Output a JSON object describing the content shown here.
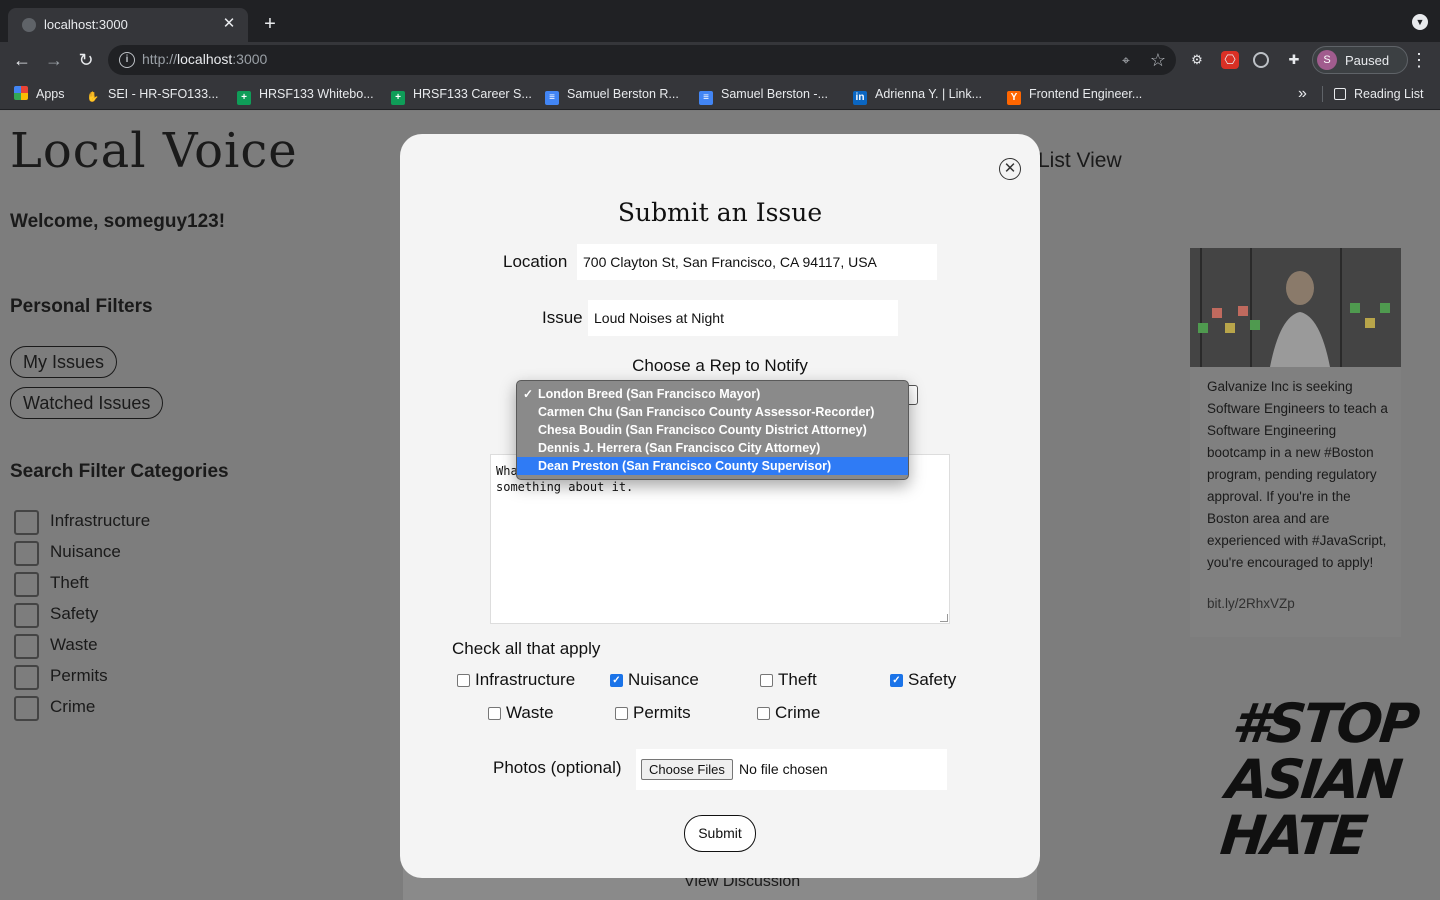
{
  "browser": {
    "tab_title": "localhost:3000",
    "url_scheme": "http://",
    "url_host": "localhost",
    "url_port": ":3000",
    "profile_initial": "S",
    "profile_label": "Paused",
    "bookmarks": [
      {
        "label": "Apps",
        "icon": "apps-grid-icon"
      },
      {
        "label": "SEI - HR-SFO133...",
        "icon": "hand-icon"
      },
      {
        "label": "HRSF133 Whitebo...",
        "icon": "sheets-icon"
      },
      {
        "label": "HRSF133 Career S...",
        "icon": "sheets-icon"
      },
      {
        "label": "Samuel Berston R...",
        "icon": "docs-icon"
      },
      {
        "label": "Samuel Berston -...",
        "icon": "docs-icon"
      },
      {
        "label": "Adrienna Y. | Link...",
        "icon": "linkedin-icon"
      },
      {
        "label": "Frontend Engineer...",
        "icon": "ycombinator-icon"
      }
    ],
    "reading_list": "Reading List"
  },
  "page": {
    "logo": "Local Voice",
    "welcome": "Welcome, someguy123!",
    "personal_filters_heading": "Personal Filters",
    "my_issues": "My Issues",
    "watched_issues": "Watched Issues",
    "search_filter_heading": "Search Filter Categories",
    "categories": [
      "Infrastructure",
      "Nuisance",
      "Theft",
      "Safety",
      "Waste",
      "Permits",
      "Crime"
    ],
    "list_view_partial": "List View",
    "ad_text": "Galvanize Inc is seeking Software Engineers to teach a Software Engineering bootcamp in a new #Boston program, pending regulatory approval. If you're in the Boston area and are experienced with #JavaScript, you're encouraged to apply!",
    "ad_link": "bit.ly/2RhxVZp",
    "stop_asian_hate": [
      "#STOP",
      "ASIAN",
      "HATE"
    ],
    "view_discussion": "View Discussion"
  },
  "modal": {
    "title": "Submit an Issue",
    "location_label": "Location",
    "location_value": "700 Clayton St, San Francisco, CA 94117, USA",
    "issue_label": "Issue",
    "issue_value": "Loud Noises at Night",
    "rep_label": "Choose a Rep to Notify",
    "rep_options": [
      "London Breed (San Francisco Mayor)",
      "Carmen Chu (San Francisco County Assessor-Recorder)",
      "Chesa Boudin (San Francisco County District Attorney)",
      "Dennis J. Herrera (San Francisco City Attorney)",
      "Dean Preston (San Francisco County Supervisor)"
    ],
    "rep_selected_index": 0,
    "rep_highlighted_index": 4,
    "description_visible": "Wha                                                   \nsomething about it.",
    "check_heading": "Check all that apply",
    "checkboxes": [
      {
        "label": "Infrastructure",
        "checked": false
      },
      {
        "label": "Nuisance",
        "checked": true
      },
      {
        "label": "Theft",
        "checked": false
      },
      {
        "label": "Safety",
        "checked": true
      },
      {
        "label": "Waste",
        "checked": false
      },
      {
        "label": "Permits",
        "checked": false
      },
      {
        "label": "Crime",
        "checked": false
      }
    ],
    "photos_label": "Photos (optional)",
    "choose_files": "Choose Files",
    "no_file": "No file chosen",
    "submit": "Submit"
  },
  "colors": {
    "overlay_page": "#7d7d7d",
    "modal_bg": "#f4f4f4",
    "dropdown_highlight": "#2f7bf5",
    "checkbox_checked": "#1a73e8"
  }
}
